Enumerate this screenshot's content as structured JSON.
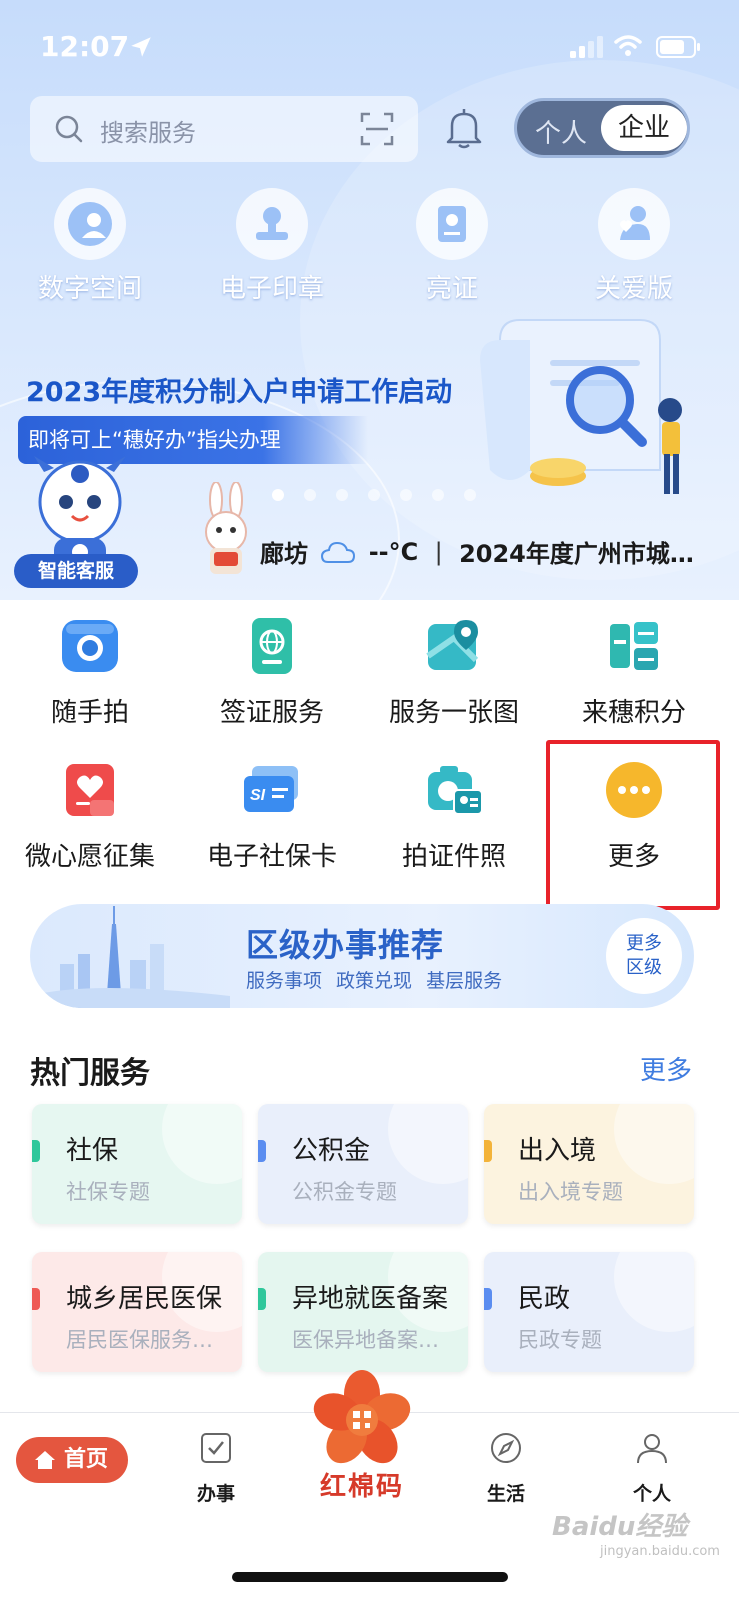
{
  "status_bar": {
    "time": "12:07"
  },
  "header": {
    "search_placeholder": "搜索服务",
    "toggle": {
      "person": "个人",
      "enterprise": "企业",
      "selected": "企业"
    }
  },
  "quick_actions": [
    {
      "label": "数字空间",
      "icon": "digital-space-icon"
    },
    {
      "label": "电子印章",
      "icon": "seal-icon"
    },
    {
      "label": "亮证",
      "icon": "certificate-icon"
    },
    {
      "label": "关爱版",
      "icon": "care-icon"
    }
  ],
  "banner": {
    "title": "2023年度积分制入户申请工作启动",
    "subtitle": "即将可上“穗好办”指尖办理",
    "page_count": 7,
    "active_index": 0
  },
  "assistant": {
    "label": "智能客服"
  },
  "info_strip": {
    "city": "廊坊",
    "temperature": "--°C",
    "separator": "|",
    "news": "2024年度广州市城…"
  },
  "services": [
    {
      "label": "随手拍",
      "icon": "camera-icon",
      "color": "#3a8cf0"
    },
    {
      "label": "签证服务",
      "icon": "visa-icon",
      "color": "#2fbfa8"
    },
    {
      "label": "服务一张图",
      "icon": "map-icon",
      "color": "#35b9c6"
    },
    {
      "label": "来穗积分",
      "icon": "sui-points-icon",
      "color": "#2fb8b0"
    },
    {
      "label": "微心愿征集",
      "icon": "heart-wish-icon",
      "color": "#ef4b4b"
    },
    {
      "label": "电子社保卡",
      "icon": "social-card-icon",
      "color": "#3a8cf0"
    },
    {
      "label": "拍证件照",
      "icon": "id-photo-icon",
      "color": "#35b9c6"
    },
    {
      "label": "更多",
      "icon": "more-icon",
      "color": "#f6b72c"
    }
  ],
  "district": {
    "title": "区级办事推荐",
    "subtitle": "服务事项  政策兑现  基层服务",
    "more_line1": "更多",
    "more_line2": "区级"
  },
  "hot_services": {
    "title": "热门服务",
    "more": "更多",
    "items": [
      {
        "title": "社保",
        "subtitle": "社保专题",
        "accent": "#2fc79b",
        "bg": "#e6f7f1"
      },
      {
        "title": "公积金",
        "subtitle": "公积金专题",
        "accent": "#5b8df0",
        "bg": "#e9effb"
      },
      {
        "title": "出入境",
        "subtitle": "出入境专题",
        "accent": "#f3b33a",
        "bg": "#fcf3df"
      },
      {
        "title": "城乡居民医保",
        "subtitle": "居民医保服务…",
        "accent": "#ee5a55",
        "bg": "#fde9e8"
      },
      {
        "title": "异地就医备案",
        "subtitle": "医保异地备案…",
        "accent": "#2fc79b",
        "bg": "#e4f6ef"
      },
      {
        "title": "民政",
        "subtitle": "民政专题",
        "accent": "#5b8df0",
        "bg": "#e9effb"
      }
    ]
  },
  "tabbar": {
    "home": "首页",
    "tasks": "办事",
    "center": "红棉码",
    "life": "生活",
    "personal": "个人"
  },
  "colors": {
    "accent_blue": "#2a62c8",
    "highlight_red": "#e8222a",
    "home_tab": "#e4563f"
  },
  "watermark": {
    "brand": "Baidu经验",
    "url": "jingyan.baidu.com"
  }
}
